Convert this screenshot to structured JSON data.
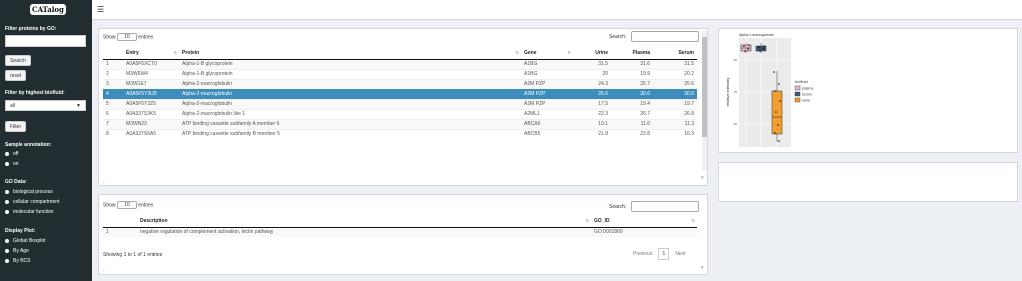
{
  "app": {
    "logo_text": "CATalog",
    "menu_icon": "hamburger-icon"
  },
  "sidebar": {
    "filter_go_label": "Filter proteins by GO:",
    "search_button": "Search",
    "reset_button": "reset",
    "filter_biofluid_label": "Filter by highest biofluid:",
    "biofluid_value": "all",
    "filter_button": "Filter",
    "sample_annotation_label": "Sample annotation:",
    "sample_annotation_options": [
      "off",
      "on"
    ],
    "go_data_label": "GO Data:",
    "go_data_options": [
      "biological process",
      "cellular compartment",
      "molecular function"
    ],
    "display_plot_label": "Display Plot:",
    "display_plot_options": [
      "Global Boxplot",
      "By Age",
      "By BCS"
    ]
  },
  "main_table": {
    "show_label": "Show",
    "entries_value": "10",
    "entries_label": "entries",
    "search_label": "Search:",
    "columns": [
      "",
      "Entry",
      "Protein",
      "Gene",
      "Urine",
      "Plasma",
      "Serum"
    ],
    "rows": [
      [
        "1",
        "A0A5F5XCT0",
        "Alpha-1-B glycoprotein",
        "A1BG",
        "31.5",
        "31.6",
        "31.5"
      ],
      [
        "2",
        "M3W6W4",
        "Alpha-1-B glycoprotein",
        "A1BG",
        "20",
        "19.9",
        "20.2"
      ],
      [
        "3",
        "M3W1E7",
        "Alpha-2-macroglobulin",
        "A2M PZP",
        "24.3",
        "25.7",
        "25.6"
      ],
      [
        "4",
        "A0A5F5Y3U9",
        "Alpha-2-macroglobulin",
        "A2M PZP",
        "26.6",
        "30.6",
        "30.6"
      ],
      [
        "5",
        "A0A5F5Y3Z6",
        "Alpha-2-macroglobulin",
        "A2M PZP",
        "17.5",
        "19.4",
        "19.7"
      ],
      [
        "6",
        "A0A337S3K5",
        "Alpha-2-macroglobulin like 1",
        "A2ML1",
        "22.3",
        "26.7",
        "26.8"
      ],
      [
        "7",
        "M3WN23",
        "ATP binding cassette subfamily A member 6",
        "ABCA6",
        "19.1",
        "11.6",
        "11.3"
      ],
      [
        "8",
        "A0A337S6A5",
        "ATP binding cassette subfamily B member 5",
        "ABCB5",
        "21.8",
        "22.8",
        "16.3"
      ]
    ]
  },
  "go_table": {
    "show_label": "Show",
    "entries_value": "10",
    "entries_label": "entries",
    "search_label": "Search:",
    "columns": [
      "",
      "Description",
      "GO_ID"
    ],
    "rows": [
      [
        "1",
        "negative regulation of complement activation, lectin pathway",
        "GO:0001869"
      ]
    ],
    "info": "Showing 1 to 1 of 1 entries",
    "prev": "Previous",
    "page": "1",
    "next": "Next"
  },
  "plot": {
    "title": "Alpha-2-macroglobulin",
    "ylabel": "relative intensity",
    "legend_title": "biofluid",
    "legend": [
      {
        "name": "plasma",
        "color": "#e7b9cc"
      },
      {
        "name": "serum",
        "color": "#3d5a80"
      },
      {
        "name": "urine",
        "color": "#f0a030"
      }
    ],
    "yticks": [
      "30",
      "25",
      "20"
    ]
  }
}
